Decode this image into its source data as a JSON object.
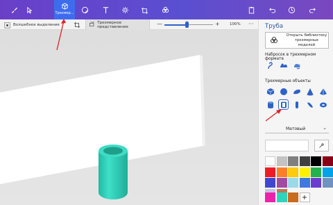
{
  "toolbar": {
    "active_label": "Трехмер...",
    "tools": [
      "brush-icon",
      "select-icon",
      "3d-shapes-icon",
      "sticker-icon",
      "text-icon",
      "effects-icon",
      "canvas-icon",
      "paste-icon",
      "undo-icon",
      "history-icon",
      "redo-icon"
    ]
  },
  "subbar": {
    "magic_select_label": "Волшебное выделение",
    "view3d_label": "Трехмерное представление",
    "zoom_minus": "—",
    "zoom_plus": "+",
    "zoom_percent": "100%",
    "zoom_level": 0.47,
    "more": "···"
  },
  "panel": {
    "title": "Труба",
    "library_button": "Открыть библиотеку трехмерных моделей",
    "doodle_heading": "Набросок в трехмерном формате",
    "objects_heading": "Трехмерные объекты",
    "doodle_tools": [
      "sharp-doodle-icon",
      "soft-doodle-icon",
      "doodle-3d-icon"
    ],
    "objects_row1": [
      "cube-icon",
      "sphere-icon",
      "hemisphere-icon",
      "cone-icon",
      "pyramid-icon"
    ],
    "objects_row2": [
      "cylinder-icon",
      "tube-icon",
      "capsule-icon",
      "torus-icon",
      "donut-icon"
    ],
    "selected_object": "tube-icon",
    "material": "Матовый",
    "palette": [
      "#ffffff",
      "#c3c3c3",
      "#7f7f7f",
      "#404040",
      "#000000",
      "#880015",
      "#ed1c24",
      "#ff7f27",
      "#ffc90e",
      "#fff200",
      "#22b14c",
      "#00a2e8",
      "#3f48cc",
      "#a349a4",
      "#99d9ea",
      "#3f78e0",
      "#6a3ccf",
      "#7092be",
      "#c8bfe7",
      "#b97a57"
    ],
    "custom_colors": [
      "#ee22aa",
      "#2fd3bd",
      "#c86a20"
    ],
    "add_color": "+"
  },
  "canvas": {
    "object_color": "#2fd3bd"
  }
}
